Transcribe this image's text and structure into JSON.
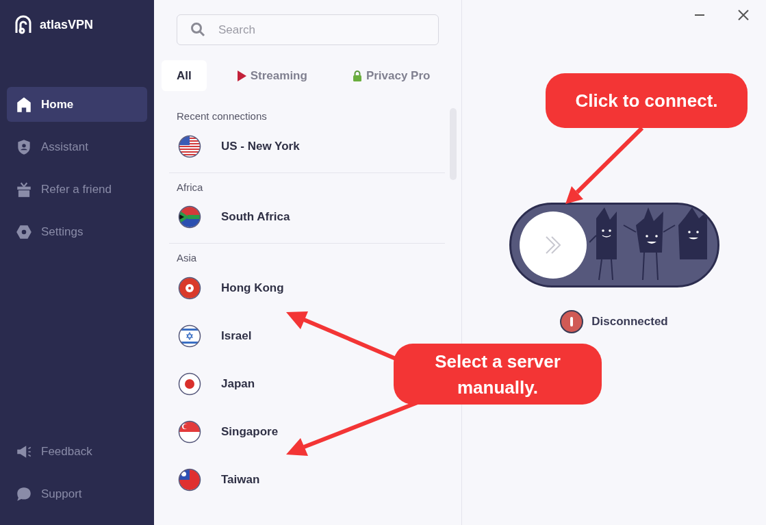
{
  "brand": {
    "name": "atlasVPN"
  },
  "sidebar": {
    "items": [
      {
        "label": "Home",
        "kind": "home",
        "selected": true
      },
      {
        "label": "Assistant",
        "kind": "assistant",
        "selected": false
      },
      {
        "label": "Refer a friend",
        "kind": "gift",
        "selected": false
      },
      {
        "label": "Settings",
        "kind": "settings",
        "selected": false
      }
    ],
    "footer_items": [
      {
        "label": "Feedback",
        "kind": "feedback"
      },
      {
        "label": "Support",
        "kind": "support"
      }
    ]
  },
  "search": {
    "placeholder": "Search"
  },
  "tabs": [
    {
      "label": "All",
      "kind": "plain",
      "selected": true
    },
    {
      "label": "Streaming",
      "kind": "streaming",
      "selected": false
    },
    {
      "label": "Privacy Pro",
      "kind": "privacy",
      "selected": false
    }
  ],
  "sections": [
    {
      "title": "Recent connections",
      "servers": [
        {
          "name": "US - New York",
          "kind": "us"
        }
      ]
    },
    {
      "title": "Africa",
      "servers": [
        {
          "name": "South Africa",
          "kind": "za"
        }
      ]
    },
    {
      "title": "Asia",
      "servers": [
        {
          "name": "Hong Kong",
          "kind": "hk"
        },
        {
          "name": "Israel",
          "kind": "il"
        },
        {
          "name": "Japan",
          "kind": "jp"
        },
        {
          "name": "Singapore",
          "kind": "sg"
        },
        {
          "name": "Taiwan",
          "kind": "tw"
        }
      ]
    }
  ],
  "connection": {
    "connected": false,
    "status": "Disconnected"
  },
  "annotations": [
    {
      "text": "Click to connect."
    },
    {
      "text": "Select a server manually."
    }
  ]
}
